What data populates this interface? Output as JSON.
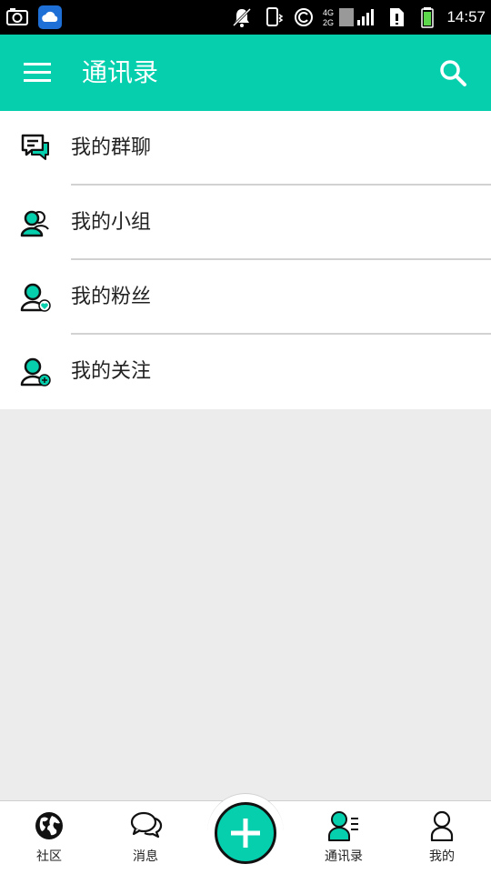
{
  "status_bar": {
    "time": "14:57",
    "network_label": "4G"
  },
  "header": {
    "title": "通讯录",
    "accent": "#06cfae"
  },
  "contact_menu": [
    {
      "id": "groups",
      "label": "我的群聊",
      "icon": "group-chat-icon"
    },
    {
      "id": "teams",
      "label": "我的小组",
      "icon": "team-icon"
    },
    {
      "id": "fans",
      "label": "我的粉丝",
      "icon": "follower-heart-icon"
    },
    {
      "id": "following",
      "label": "我的关注",
      "icon": "following-plus-icon"
    }
  ],
  "bottom_nav": {
    "tabs": [
      {
        "label": "社区",
        "icon": "globe-icon"
      },
      {
        "label": "消息",
        "icon": "chat-bubbles-icon"
      },
      {
        "label": "通讯录",
        "icon": "contacts-icon",
        "active": true
      },
      {
        "label": "我的",
        "icon": "person-icon"
      }
    ],
    "fab_icon": "plus-icon"
  }
}
